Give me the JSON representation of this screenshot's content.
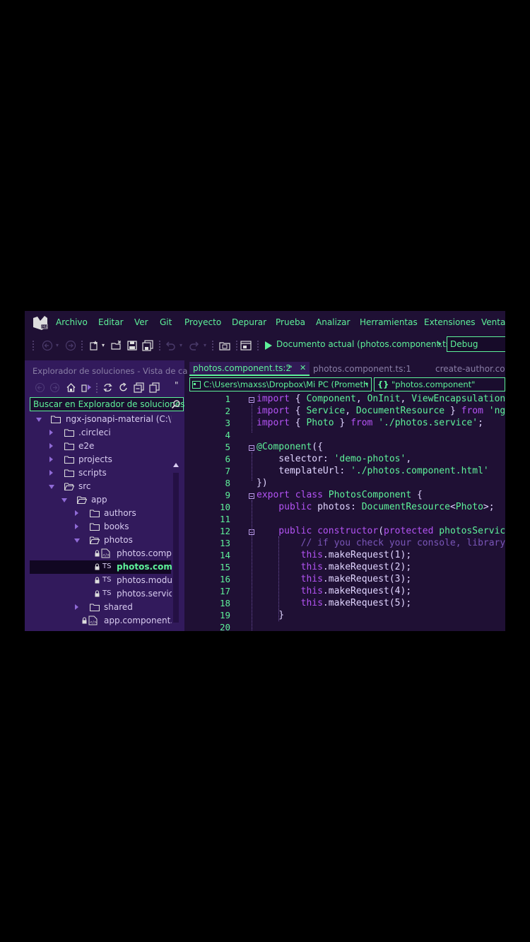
{
  "menu": [
    "Archivo",
    "Editar",
    "Ver",
    "Git",
    "Proyecto",
    "Depurar",
    "Prueba",
    "Analizar",
    "Herramientas",
    "Extensiones",
    "Ventan"
  ],
  "toolbar": {
    "run_label": "Documento actual (photos.component.ts)",
    "config": "Debug"
  },
  "explorer": {
    "title": "Explorador de soluciones - Vista de car...",
    "search_placeholder": "Buscar en Explorador de soluciones",
    "items": [
      {
        "label": "ngx-jsonapi-material (C:\\Use",
        "kind": "solution",
        "state": "expanded"
      },
      {
        "label": ".circleci",
        "kind": "folder",
        "state": "collapsed"
      },
      {
        "label": "e2e",
        "kind": "folder",
        "state": "collapsed"
      },
      {
        "label": "projects",
        "kind": "folder",
        "state": "collapsed"
      },
      {
        "label": "scripts",
        "kind": "folder",
        "state": "collapsed"
      },
      {
        "label": "src",
        "kind": "folder",
        "state": "expanded"
      },
      {
        "label": "app",
        "kind": "folder",
        "state": "expanded"
      },
      {
        "label": "authors",
        "kind": "folder",
        "state": "collapsed"
      },
      {
        "label": "books",
        "kind": "folder",
        "state": "collapsed"
      },
      {
        "label": "photos",
        "kind": "folder",
        "state": "expanded"
      },
      {
        "label": "photos.compo",
        "kind": "html",
        "state": "locked"
      },
      {
        "label": "photos.compo",
        "kind": "ts",
        "state": "locked-selected",
        "badge": "TS"
      },
      {
        "label": "photos.module",
        "kind": "ts",
        "state": "locked",
        "badge": "TS"
      },
      {
        "label": "photos.service.",
        "kind": "ts",
        "state": "locked",
        "badge": "TS"
      },
      {
        "label": "shared",
        "kind": "folder",
        "state": "collapsed"
      },
      {
        "label": "app.component.h",
        "kind": "html",
        "state": "locked"
      }
    ]
  },
  "editor": {
    "tabs": [
      {
        "label": "photos.component.ts:2",
        "pin": "⊸",
        "close": "✕",
        "active": true
      },
      {
        "label": "photos.component.ts:1",
        "active": false
      },
      {
        "label": "create-author.com",
        "active": false
      }
    ],
    "nav_file": "C:\\Users\\maxss\\Dropbox\\Mi PC (Prometh",
    "nav_member": "\"photos.component\"",
    "line_numbers": [
      "1",
      "2",
      "3",
      "4",
      "5",
      "6",
      "7",
      "8",
      "9",
      "10",
      "11",
      "12",
      "13",
      "14",
      "15",
      "16",
      "17",
      "18",
      "19",
      "20"
    ],
    "code": [
      [
        [
          "kw",
          "import"
        ],
        [
          "pl",
          " { "
        ],
        [
          "ty",
          "Component"
        ],
        [
          "pl",
          ", "
        ],
        [
          "ty",
          "OnInit"
        ],
        [
          "pl",
          ", "
        ],
        [
          "ty",
          "ViewEncapsulation"
        ],
        [
          "pl",
          " }"
        ]
      ],
      [
        [
          "kw",
          "import"
        ],
        [
          "pl",
          " { "
        ],
        [
          "ty",
          "Service"
        ],
        [
          "pl",
          ", "
        ],
        [
          "ty",
          "DocumentResource"
        ],
        [
          "pl",
          " } "
        ],
        [
          "kw",
          "from"
        ],
        [
          "pl",
          " "
        ],
        [
          "st",
          "'ngx-"
        ]
      ],
      [
        [
          "kw",
          "import"
        ],
        [
          "pl",
          " { "
        ],
        [
          "ty",
          "Photo"
        ],
        [
          "pl",
          " } "
        ],
        [
          "kw",
          "from"
        ],
        [
          "pl",
          " "
        ],
        [
          "st",
          "'./photos.service'"
        ],
        [
          "pl",
          ";"
        ]
      ],
      [],
      [
        [
          "ty",
          "@Component"
        ],
        [
          "pl",
          "({"
        ]
      ],
      [
        [
          "pl",
          "    selector: "
        ],
        [
          "st",
          "'demo-photos'"
        ],
        [
          "pl",
          ","
        ]
      ],
      [
        [
          "pl",
          "    templateUrl: "
        ],
        [
          "st",
          "'./photos.component.html'"
        ]
      ],
      [
        [
          "pl",
          "})"
        ]
      ],
      [
        [
          "kw",
          "export class "
        ],
        [
          "ty",
          "PhotosComponent"
        ],
        [
          "pl",
          " {"
        ]
      ],
      [
        [
          "kw",
          "    public "
        ],
        [
          "pl",
          "photos: "
        ],
        [
          "ty",
          "DocumentResource"
        ],
        [
          "pl",
          "<"
        ],
        [
          "ty",
          "Photo"
        ],
        [
          "pl",
          ">;"
        ]
      ],
      [],
      [
        [
          "kw",
          "    public constructor"
        ],
        [
          "pl",
          "("
        ],
        [
          "kw",
          "protected "
        ],
        [
          "ty",
          "photosService"
        ]
      ],
      [
        [
          "cm",
          "        // if you check your console, library m"
        ]
      ],
      [
        [
          "kw",
          "        this"
        ],
        [
          "pl",
          ".makeRequest(1);"
        ]
      ],
      [
        [
          "kw",
          "        this"
        ],
        [
          "pl",
          ".makeRequest(2);"
        ]
      ],
      [
        [
          "kw",
          "        this"
        ],
        [
          "pl",
          ".makeRequest(3);"
        ]
      ],
      [
        [
          "kw",
          "        this"
        ],
        [
          "pl",
          ".makeRequest(4);"
        ]
      ],
      [
        [
          "kw",
          "        this"
        ],
        [
          "pl",
          ".makeRequest(5);"
        ]
      ],
      [
        [
          "pl",
          "    }"
        ]
      ],
      []
    ]
  },
  "colors": {
    "accent": "#5ef29a",
    "keyword": "#b454f5",
    "background": "#1f1034",
    "explorer": "#321a5c",
    "comment": "#7a56b8"
  }
}
